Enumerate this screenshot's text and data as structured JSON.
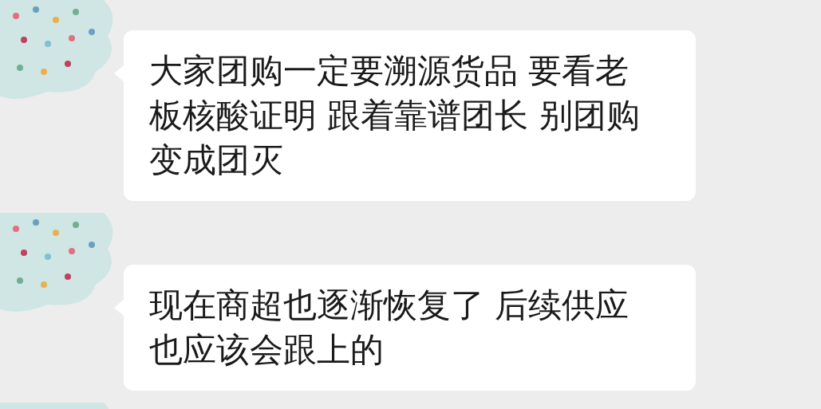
{
  "messages": [
    {
      "avatar": {
        "kind": "picture"
      },
      "lines": [
        "大家团购一定要溯源货品 要看老",
        "板核酸证明 跟着靠谱团长 别团购",
        "变成团灭"
      ]
    },
    {
      "avatar": {
        "kind": "picture"
      },
      "lines": [
        "现在商超也逐渐恢复了 后续供应",
        "也应该会跟上的"
      ]
    },
    {
      "avatar": {
        "kind": "picture"
      }
    }
  ]
}
